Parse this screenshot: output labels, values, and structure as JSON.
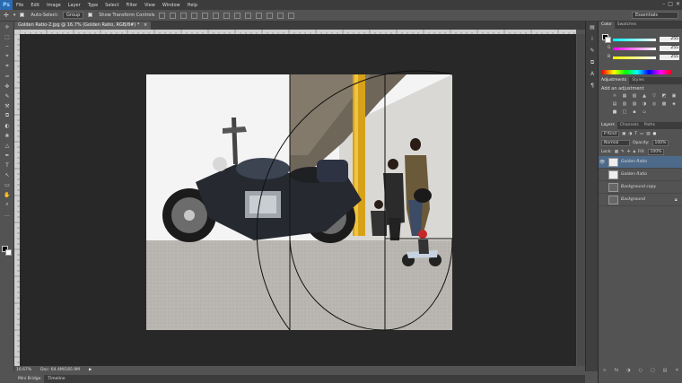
{
  "menubar": {
    "logo": "Ps",
    "items": [
      "File",
      "Edit",
      "Image",
      "Layer",
      "Type",
      "Select",
      "Filter",
      "View",
      "Window",
      "Help"
    ],
    "window_controls": [
      "–",
      "□",
      "✕"
    ]
  },
  "options": {
    "auto_select_label": "Auto-Select:",
    "auto_select_value": "Group",
    "show_transform_label": "Show Transform Controls",
    "workspace": "Essentials"
  },
  "document": {
    "tab_label": "Golden Ratio-2.jpg @ 16.7% (Golden Ratio, RGB/8#) *",
    "tab_close": "×"
  },
  "status": {
    "zoom": "16.67%",
    "doc_size": "Doc: 64.4M/185.9M"
  },
  "bottom_tabs": [
    "Mini Bridge",
    "Timeline"
  ],
  "color_panel": {
    "tabs": [
      "Color",
      "Swatches"
    ],
    "channels": [
      {
        "label": "R",
        "value": "255",
        "color": "#d64545"
      },
      {
        "label": "G",
        "value": "255",
        "color": "#45c045"
      },
      {
        "label": "B",
        "value": "255",
        "color": "#4575d6"
      }
    ]
  },
  "adjustments_panel": {
    "tabs": [
      "Adjustments",
      "Styles"
    ],
    "title": "Add an adjustment",
    "icons": [
      "☼",
      "▦",
      "▧",
      "▲",
      "▽",
      "◩",
      "▣",
      "▤",
      "▥",
      "▨",
      "◑",
      "◎",
      "▩",
      "◈",
      "■",
      "□",
      "▪",
      "▫"
    ]
  },
  "layers_panel": {
    "tabs": [
      "Layers",
      "Channels",
      "Paths"
    ],
    "filter_kind": "P Kind",
    "blend_mode": "Normal",
    "opacity_label": "Opacity:",
    "opacity_value": "100%",
    "lock_label": "Lock:",
    "fill_label": "Fill:",
    "fill_value": "100%",
    "layers": [
      {
        "name": "Golden Ratio",
        "visible": true,
        "selected": true,
        "locked": false
      },
      {
        "name": "Golden Ratio",
        "visible": false,
        "selected": false,
        "locked": false
      },
      {
        "name": "Background copy",
        "visible": false,
        "selected": false,
        "locked": false
      },
      {
        "name": "Background",
        "visible": false,
        "selected": false,
        "locked": true
      }
    ],
    "footer_icons": [
      "∞",
      "fx",
      "◑",
      "○",
      "□",
      "▤",
      "✕"
    ]
  },
  "tools": [
    "✛",
    "⬚",
    "⌢",
    "⌖",
    "⌗",
    "✑",
    "✙",
    "✎",
    "⚒",
    "⧉",
    "◐",
    "❀",
    "△",
    "✒",
    "T",
    "↖",
    "▭",
    "✋",
    "⌕",
    "…"
  ],
  "colors": {
    "canvas_bg": "#282828",
    "panel_bg": "#535353",
    "menubar_bg": "#3c3c3c",
    "selected_layer": "#4d6a8a",
    "ps_blue": "#2a6ab1"
  }
}
